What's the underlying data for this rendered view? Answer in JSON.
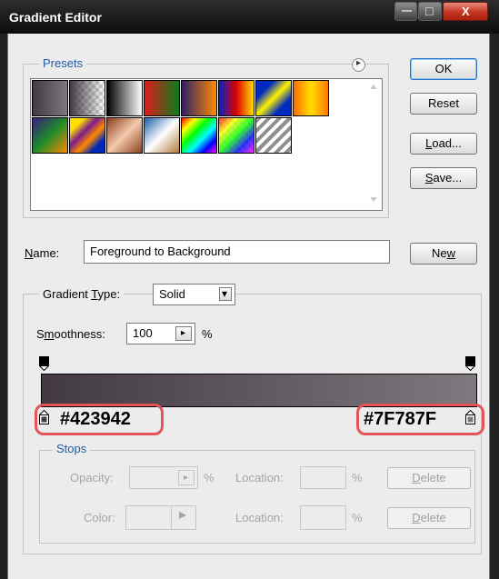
{
  "window": {
    "title": "Gradient Editor",
    "minimize_glyph": "—",
    "maximize_glyph": "□",
    "close_glyph": "X"
  },
  "presets": {
    "legend": "Presets",
    "menu_arrow_glyph": "▸",
    "swatches": [
      {
        "name": "Foreground to Background",
        "css": "linear-gradient(to right,#423942,#7f787f)"
      },
      {
        "name": "Foreground to Transparent",
        "css": "linear-gradient(to right,#423942,rgba(66,57,66,0)),repeating-conic-gradient(#cfcfcf 0% 25%,#ffffff 0% 50%) 0 0/8px 8px"
      },
      {
        "name": "Black, White",
        "css": "linear-gradient(to right,#000,#fff)"
      },
      {
        "name": "Red, Green",
        "css": "linear-gradient(to right,#e01b1b,#0a7a1a)"
      },
      {
        "name": "Violet, Orange",
        "css": "linear-gradient(to right,#2c2068,#ff8a00)"
      },
      {
        "name": "Blue, Red, Yellow",
        "css": "linear-gradient(to right,#0022c8,#e00000,#ffe000)"
      },
      {
        "name": "Blue, Yellow, Blue",
        "css": "linear-gradient(135deg,#002ac0 25%,#fff200 50%,#002ac0 75%)"
      },
      {
        "name": "Orange, Yellow, Orange",
        "css": "linear-gradient(to right,#ff6a00,#ffe000,#ff7800)"
      },
      {
        "name": "Violet, Green, Orange",
        "css": "linear-gradient(135deg,#3a1d86,#1e8c28,#ff8a00)"
      },
      {
        "name": "Yellow, Violet, Orange, Blue",
        "css": "linear-gradient(135deg,#ffdf00 20%,#7a1b8a 40%,#ff8a00 60%,#0028b8 80%)"
      },
      {
        "name": "Copper",
        "css": "linear-gradient(135deg,#8a3f1d,#f3c9ad 50%,#8a3f1d)"
      },
      {
        "name": "Chrome",
        "css": "linear-gradient(135deg,#1d5ea8,#ffffff 50%,#b07a3a)"
      },
      {
        "name": "Spectrum",
        "css": "linear-gradient(135deg,#ff0000,#ffff00,#00ff00,#00ffff,#0000ff,#ff00ff)"
      },
      {
        "name": "Transparent Rainbow",
        "css": "linear-gradient(135deg,rgba(255,0,0,.8),rgba(255,255,0,.8),rgba(0,255,0,.8),rgba(0,0,255,.8),rgba(255,0,255,.8)),repeating-conic-gradient(#cfcfcf 0% 25%,#ffffff 0% 50%) 0 0/8px 8px"
      },
      {
        "name": "Transparent Stripes",
        "css": "repeating-linear-gradient(135deg,#8f8f8f 0 4px,#ffffff 4px 8px)"
      }
    ]
  },
  "buttons": {
    "ok": "OK",
    "reset": "Reset",
    "load_pre": "",
    "load_u": "L",
    "load_post": "oad...",
    "save_pre": "",
    "save_u": "S",
    "save_post": "ave...",
    "new_pre": "Ne",
    "new_u": "w",
    "new_post": ""
  },
  "name_field": {
    "label_u": "N",
    "label_post": "ame:",
    "value": "Foreground to Background"
  },
  "gradient": {
    "type_label_pre": "Gradient ",
    "type_label_u": "T",
    "type_label_post": "ype:",
    "type_value": "Solid",
    "dropdown_glyph": "▾",
    "smoothness_label_pre": "S",
    "smoothness_label_u": "m",
    "smoothness_label_post": "oothness:",
    "smoothness_value": "100",
    "smoothness_arrow_glyph": "▸",
    "smoothness_unit": "%",
    "start_color": "#423942",
    "end_color": "#7F787F",
    "start_hex_label": "#423942",
    "end_hex_label": "#7F787F",
    "callout_color": "#e55458"
  },
  "stops": {
    "legend": "Stops",
    "opacity_label": "Opacity:",
    "opacity_arrow_glyph": "▸",
    "opacity_unit": "%",
    "opacity_location_label": "Location:",
    "opacity_location_unit": "%",
    "delete_pre": "",
    "delete_u": "D",
    "delete_post": "elete",
    "color_label": "Color:",
    "color_arrow_glyph": "▸",
    "color_location_label": "Location:",
    "color_location_unit": "%",
    "delete2_pre": "",
    "delete2_u": "D",
    "delete2_post": "elete"
  }
}
